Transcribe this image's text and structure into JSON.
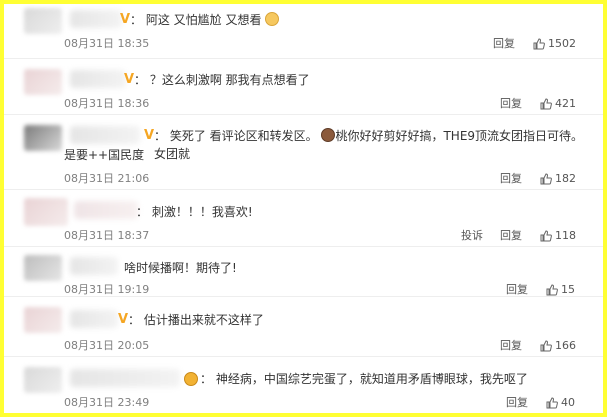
{
  "comments": [
    {
      "text": "：  阿这 又怕尴尬 又想看",
      "date": "08月31日 18:35",
      "reply": "回复",
      "likes": "1502",
      "report": ""
    },
    {
      "text": "：  ？这么刺激啊 那我有点想看了",
      "date": "08月31日 18:36",
      "reply": "回复",
      "likes": "421",
      "report": ""
    },
    {
      "text_line1": "：  笑死了 看评论区和转发区。",
      "text_line1b": "桃你好好剪好好搞，THE9顶流女团指日可待。女团就",
      "text_line2": "是要++国民度",
      "date": "08月31日 21:06",
      "reply": "回复",
      "likes": "182",
      "report": ""
    },
    {
      "text": "：  刺激！！！我喜欢!",
      "date": "08月31日 18:37",
      "reply": "回复",
      "likes": "118",
      "report": "投诉"
    },
    {
      "text": "啥时候播啊！期待了!",
      "date": "08月31日 19:19",
      "reply": "回复",
      "likes": "15",
      "report": ""
    },
    {
      "text": "：  估计播出来就不这样了",
      "date": "08月31日 20:05",
      "reply": "回复",
      "likes": "166",
      "report": ""
    },
    {
      "text": "：  神经病，中国综艺完蛋了，就知道用矛盾博眼球，我先呕了",
      "date": "08月31日 23:49",
      "reply": "回复",
      "likes": "40",
      "report": ""
    }
  ],
  "colors": {
    "frame": "#ffff33",
    "badge": "#f5a623"
  }
}
